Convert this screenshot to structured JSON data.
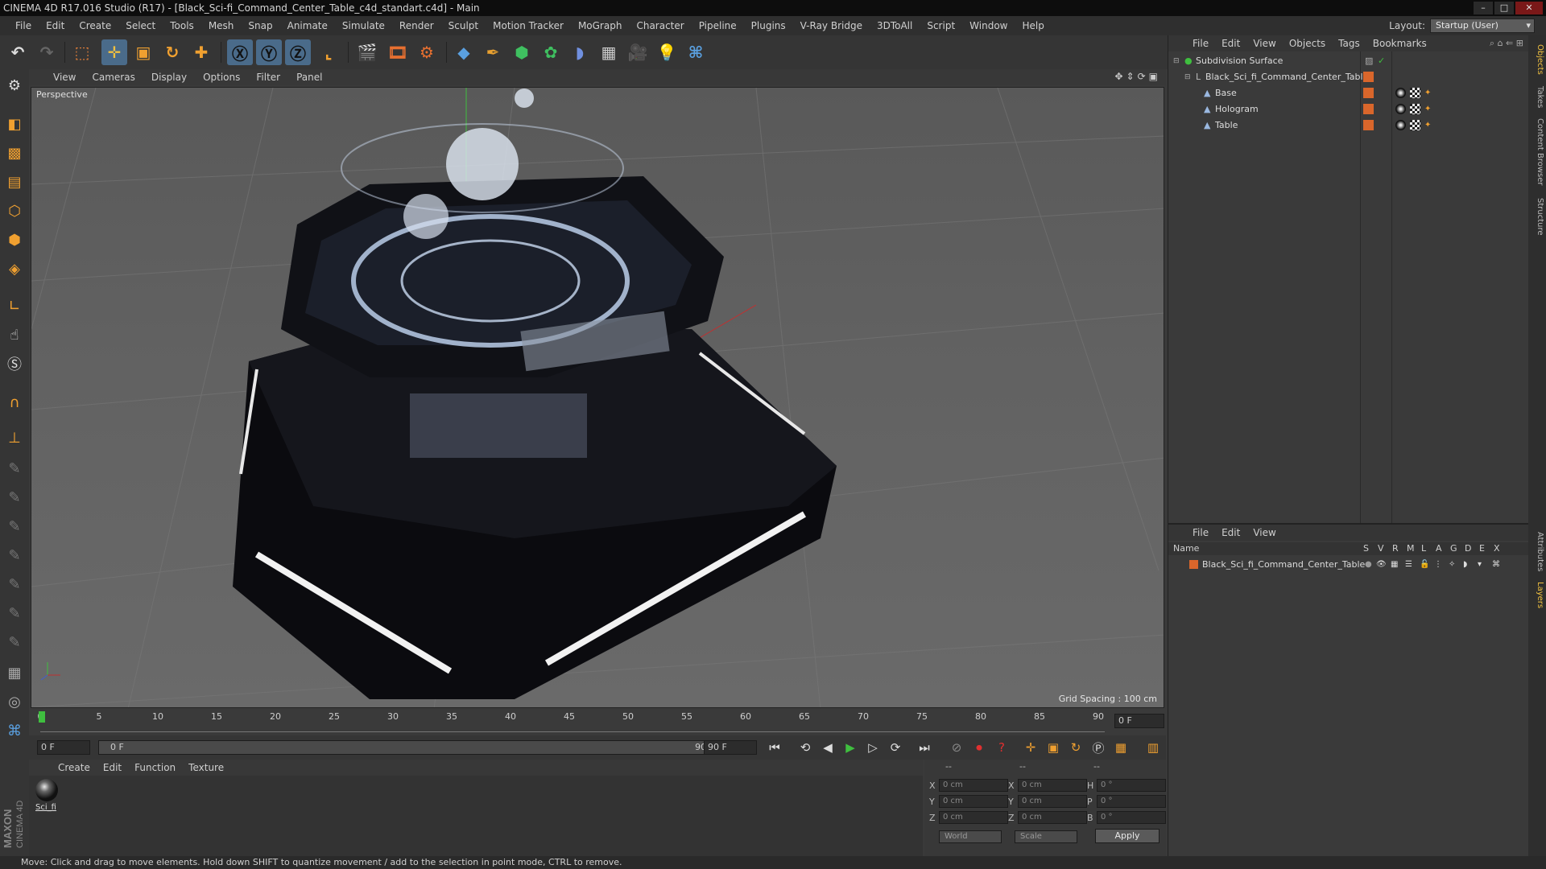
{
  "window": {
    "title": "CINEMA 4D R17.016 Studio (R17) - [Black_Sci-fi_Command_Center_Table_c4d_standart.c4d] - Main"
  },
  "menu": [
    "File",
    "Edit",
    "Create",
    "Select",
    "Tools",
    "Mesh",
    "Snap",
    "Animate",
    "Simulate",
    "Render",
    "Sculpt",
    "Motion Tracker",
    "MoGraph",
    "Character",
    "Pipeline",
    "Plugins",
    "V-Ray Bridge",
    "3DToAll",
    "Script",
    "Window",
    "Help"
  ],
  "layout": {
    "label": "Layout:",
    "value": "Startup (User)"
  },
  "viewport": {
    "menu": [
      "View",
      "Cameras",
      "Display",
      "Options",
      "Filter",
      "Panel"
    ],
    "label": "Perspective",
    "grid_spacing": "Grid Spacing : 100 cm"
  },
  "timeline": {
    "ticks": [
      "0",
      "5",
      "10",
      "15",
      "20",
      "25",
      "30",
      "35",
      "40",
      "45",
      "50",
      "55",
      "60",
      "65",
      "70",
      "75",
      "80",
      "85",
      "90"
    ],
    "current_frame_box": "0 F"
  },
  "transport": {
    "start_field": "0 F",
    "range_start": "0 F",
    "range_end": "90 F",
    "end_field": "90 F"
  },
  "materials": {
    "menu": [
      "Create",
      "Edit",
      "Function",
      "Texture"
    ],
    "items": [
      {
        "name": "Sci_fi"
      }
    ]
  },
  "coords": {
    "header": [
      "--",
      "--",
      "--"
    ],
    "rows": [
      {
        "a": "X",
        "av": "0 cm",
        "b": "X",
        "bv": "0 cm",
        "c": "H",
        "cv": "0 °"
      },
      {
        "a": "Y",
        "av": "0 cm",
        "b": "Y",
        "bv": "0 cm",
        "c": "P",
        "cv": "0 °"
      },
      {
        "a": "Z",
        "av": "0 cm",
        "b": "Z",
        "bv": "0 cm",
        "c": "B",
        "cv": "0 °"
      }
    ],
    "space": "World",
    "mode": "Scale",
    "apply": "Apply"
  },
  "status": "Move: Click and drag to move elements. Hold down SHIFT to quantize movement / add to the selection in point mode, CTRL to remove.",
  "object_manager": {
    "menu": [
      "File",
      "Edit",
      "View",
      "Objects",
      "Tags",
      "Bookmarks"
    ],
    "objects": [
      {
        "name": "Subdivision Surface",
        "level": 0
      },
      {
        "name": "Black_Sci_fi_Command_Center_Table",
        "level": 1
      },
      {
        "name": "Base",
        "level": 2
      },
      {
        "name": "Hologram",
        "level": 2
      },
      {
        "name": "Table",
        "level": 2
      }
    ]
  },
  "layer_manager": {
    "menu": [
      "File",
      "Edit",
      "View"
    ],
    "columns": [
      "Name",
      "S",
      "V",
      "R",
      "M",
      "L",
      "A",
      "G",
      "D",
      "E",
      "X"
    ],
    "layers": [
      {
        "name": "Black_Sci_fi_Command_Center_Table",
        "color": "#d9662b"
      }
    ]
  },
  "right_tabs": [
    "Objects",
    "Takes",
    "Content Browser",
    "Structure",
    "Attributes",
    "Layers"
  ],
  "colors": {
    "accent": "#4a6b8a",
    "layer": "#d9662b",
    "object_green": "#3fbf3f"
  }
}
